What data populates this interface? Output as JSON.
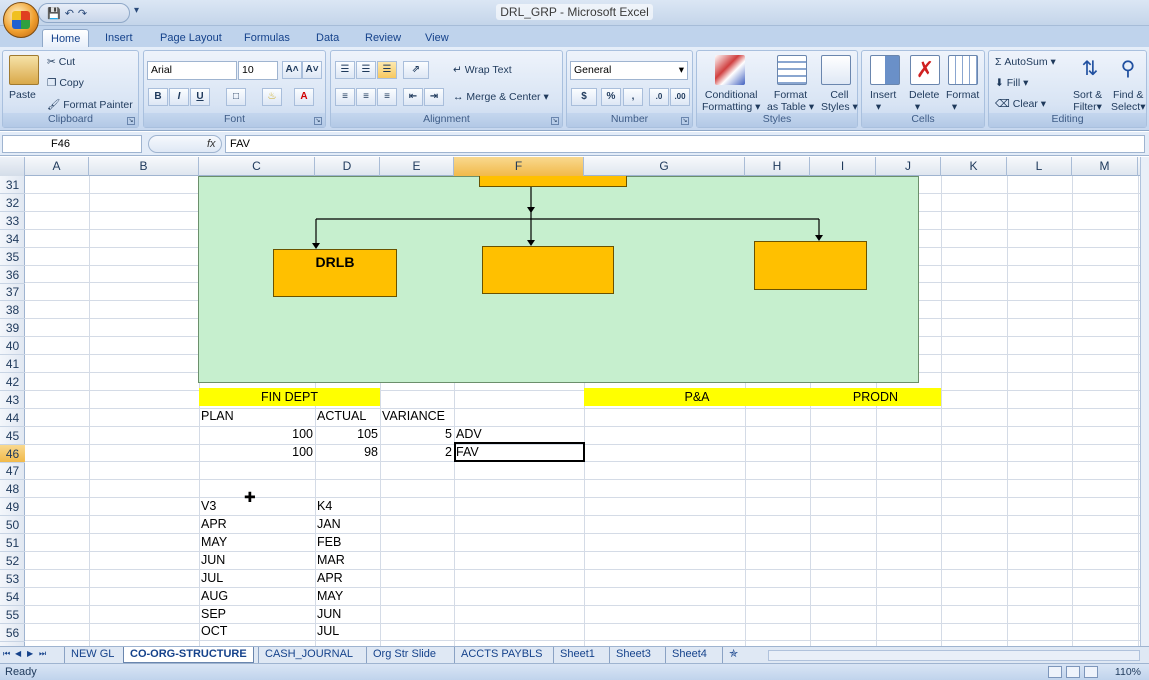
{
  "window": {
    "title": "DRL_GRP - Microsoft Excel"
  },
  "ribbon_tabs": [
    "Home",
    "Insert",
    "Page Layout",
    "Formulas",
    "Data",
    "Review",
    "View"
  ],
  "ribbon": {
    "clipboard": {
      "label": "Clipboard",
      "paste": "Paste",
      "cut": "Cut",
      "copy": "Copy",
      "format_painter": "Format Painter"
    },
    "font": {
      "label": "Font",
      "font_name": "Arial",
      "font_size": "10",
      "bold": "B",
      "italic": "I",
      "underline": "U"
    },
    "alignment": {
      "label": "Alignment",
      "wrap_text": "Wrap Text",
      "merge_center": "Merge & Center"
    },
    "number": {
      "label": "Number",
      "format": "General",
      "currency": "$",
      "percent": "%",
      "comma": ","
    },
    "styles": {
      "label": "Styles",
      "conditional_1": "Conditional",
      "conditional_2": "Formatting",
      "format_table_1": "Format",
      "format_table_2": "as Table",
      "cell_styles_1": "Cell",
      "cell_styles_2": "Styles"
    },
    "cells": {
      "label": "Cells",
      "insert": "Insert",
      "delete": "Delete",
      "format": "Format"
    },
    "editing": {
      "label": "Editing",
      "autosum": "AutoSum",
      "fill": "Fill",
      "clear": "Clear",
      "sort_1": "Sort &",
      "sort_2": "Filter",
      "find_1": "Find &",
      "find_2": "Select"
    }
  },
  "formula_bar": {
    "name_box": "F46",
    "fx": "fx",
    "formula": "FAV"
  },
  "columns": [
    "A",
    "B",
    "C",
    "D",
    "E",
    "F",
    "G",
    "H",
    "I",
    "J",
    "K",
    "L",
    "M"
  ],
  "rows": [
    "31",
    "32",
    "33",
    "34",
    "35",
    "36",
    "37",
    "38",
    "39",
    "40",
    "41",
    "42",
    "43",
    "44",
    "45",
    "46",
    "47",
    "48",
    "49",
    "50",
    "51",
    "52",
    "53",
    "54",
    "55",
    "56"
  ],
  "org_chart": {
    "box_drlb": "DRLB"
  },
  "cells": {
    "fin_dept": "FIN DEPT",
    "pa": "P&A",
    "prodn": "PRODN",
    "plan_hdr": "PLAN",
    "actual_hdr": "ACTUAL",
    "variance_hdr": "VARIANCE",
    "r45": {
      "plan": "100",
      "actual": "105",
      "variance": "5",
      "status": "ADV"
    },
    "r46": {
      "plan": "100",
      "actual": "98",
      "variance": "2",
      "status": "FAV"
    },
    "v3": "V3",
    "k4": "K4",
    "list_c": [
      "APR",
      "MAY",
      "JUN",
      "JUL",
      "AUG",
      "SEP",
      "OCT"
    ],
    "list_d": [
      "JAN",
      "FEB",
      "MAR",
      "APR",
      "MAY",
      "JUN",
      "JUL"
    ]
  },
  "sheet_tabs": [
    "NEW GL",
    "CO-ORG-STRUCTURE",
    "CASH_JOURNAL",
    "Org Str Slide",
    "ACCTS PAYBLS",
    "Sheet1",
    "Sheet3",
    "Sheet4"
  ],
  "active_sheet": "CO-ORG-STRUCTURE",
  "status": {
    "ready": "Ready",
    "zoom": "110%"
  }
}
